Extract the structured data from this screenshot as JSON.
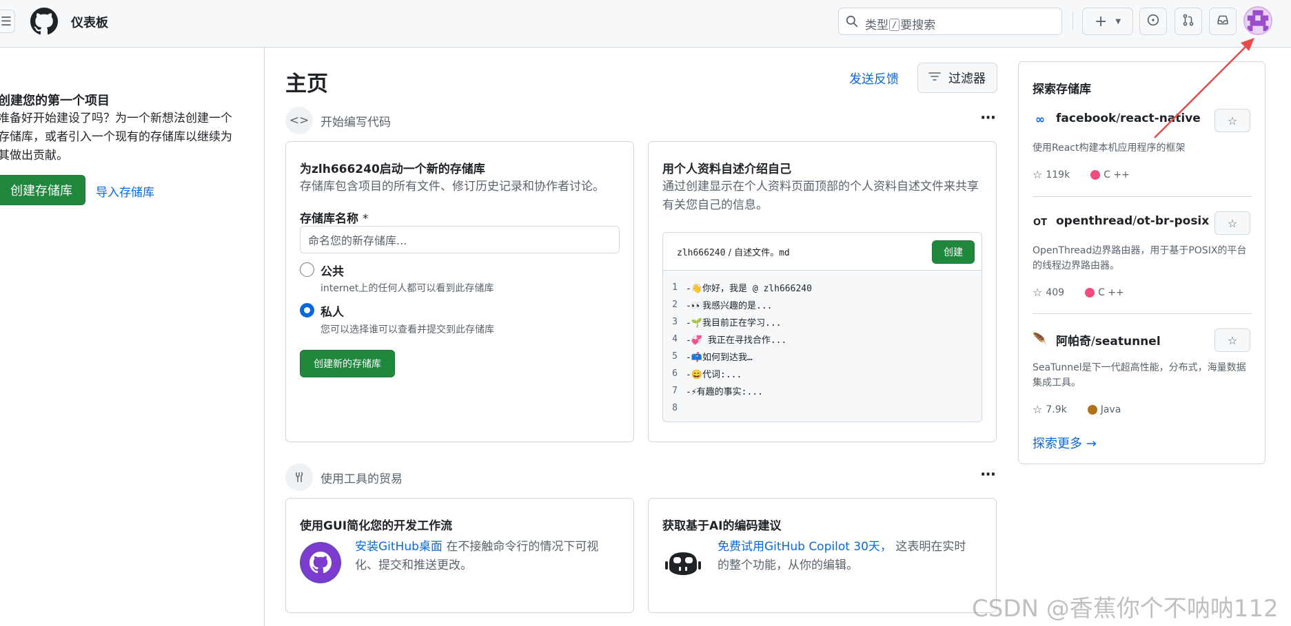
{
  "header": {
    "title": "仪表板",
    "search_prefix": "类型",
    "search_key": "/",
    "search_suffix": "要搜索",
    "plus_label": "+"
  },
  "sidebar": {
    "title": "创建您的第一个项目",
    "description": "准备好开始建设了吗？为一个新想法创建一个存储库，或者引入一个现有的存储库以继续为其做出贡献。",
    "create_button": "创建存储库",
    "import_link": "导入存储库"
  },
  "main": {
    "title": "主页",
    "feedback_link": "发送反馈",
    "filter_button": "过滤器",
    "section1_label": "开始编写代码",
    "section2_label": "使用工具的贸易",
    "new_repo_card": {
      "title": "为zlh666240启动一个新的存储库",
      "description": "存储库包含项目的所有文件、修订历史记录和协作者讨论。",
      "name_label": "存储库名称",
      "required_mark": "*",
      "name_placeholder": "命名您的新存储库...",
      "public_label": "公共",
      "public_help": "internet上的任何人都可以看到此存储库",
      "private_label": "私人",
      "private_help": "您可以选择谁可以查看并提交到此存储库",
      "submit_button": "创建新的存储库"
    },
    "readme_card": {
      "title": "用个人资料自述介绍自己",
      "description": "通过创建显示在个人资料页面顶部的个人资料自述文件来共享有关您自己的信息。",
      "file_user": "zlh666240",
      "file_sep": " / ",
      "file_name": "自述文件。md",
      "create_button": "创建",
      "lines": [
        {
          "n": "1",
          "text": "-👋你好，我是 @ zlh666240"
        },
        {
          "n": "2",
          "text": "-👀我感兴趣的是..."
        },
        {
          "n": "3",
          "text": "-🌱我目前正在学习..."
        },
        {
          "n": "4",
          "text": "-💞️ 我正在寻找合作..."
        },
        {
          "n": "5",
          "text": "-📫如何到达我…"
        },
        {
          "n": "6",
          "text": "-😄代词:..."
        },
        {
          "n": "7",
          "text": "-⚡有趣的事实:..."
        },
        {
          "n": "8",
          "text": ""
        }
      ]
    },
    "gui_card": {
      "title": "使用GUI简化您的开发工作流",
      "link": "安装GitHub桌面",
      "text": " 在不接触命令行的情况下可视化、提交和推送更改。"
    },
    "ai_card": {
      "title": "获取基于AI的编码建议",
      "link": "免费试用GitHub Copilot 30天，",
      "text": " 这表明在实时的整个功能，从你的编辑。"
    }
  },
  "explore": {
    "title": "探索存储库",
    "repos": [
      {
        "owner": "facebook",
        "name": "react-native",
        "description": "使用React构建本机应用程序的框架",
        "stars": "119k",
        "language": "C ++",
        "lang_color": "#f34b7d"
      },
      {
        "owner": "openthread",
        "name": "ot-br-posix",
        "description": "OpenThread边界路由器，用于基于POSIX的平台的线程边界路由器。",
        "stars": "409",
        "language": "C ++",
        "lang_color": "#f34b7d"
      },
      {
        "owner": "阿帕奇",
        "name": "seatunnel",
        "description": "SeaTunnel是下一代超高性能，分布式，海量数据集成工具。",
        "stars": "7.9k",
        "language": "Java",
        "lang_color": "#b07219"
      }
    ],
    "more_link": "探索更多 →"
  },
  "watermark": "CSDN @香蕉你个不呐呐112",
  "colors": {
    "accent": "#0969da",
    "green": "#1f883d",
    "annotation_arrow": "#e84c4c"
  }
}
